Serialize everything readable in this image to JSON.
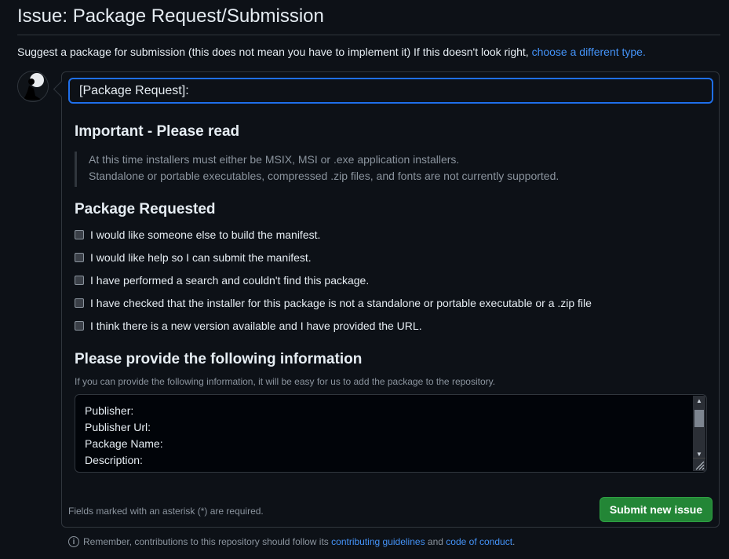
{
  "header": {
    "title": "Issue: Package Request/Submission",
    "subtitle_text": "Suggest a package for submission (this does not mean you have to implement it) If this doesn't look right,",
    "subtitle_link": "choose a different type."
  },
  "form": {
    "title_value": "[Package Request]:",
    "important": {
      "heading": "Important - Please read",
      "lines": [
        "At this time installers must either be MSIX, MSI or .exe application installers.",
        "Standalone or portable executables, compressed .zip files, and fonts are not currently supported."
      ]
    },
    "package_requested": {
      "heading": "Package Requested",
      "options": [
        "I would like someone else to build the manifest.",
        "I would like help so I can submit the manifest.",
        "I have performed a search and couldn't find this package.",
        "I have checked that the installer for this package is not a standalone or portable executable or a .zip file",
        "I think there is a new version available and I have provided the URL."
      ]
    },
    "info": {
      "heading": "Please provide the following information",
      "hint": "If you can provide the following information, it will be easy for us to add the package to the repository.",
      "textarea_lines": [
        "Publisher:",
        "Publisher Url:",
        "Package Name:",
        "Description:"
      ]
    },
    "required_note": "Fields marked with an asterisk (*) are required.",
    "submit_label": "Submit new issue"
  },
  "footer": {
    "text_before": "Remember, contributions to this repository should follow its",
    "link1": "contributing guidelines",
    "and": "and",
    "link2": "code of conduct",
    "period": "."
  },
  "colors": {
    "background": "#0d1117",
    "accent_link": "#4493f8",
    "submit_green": "#238636",
    "focus_blue": "#1f6feb"
  }
}
